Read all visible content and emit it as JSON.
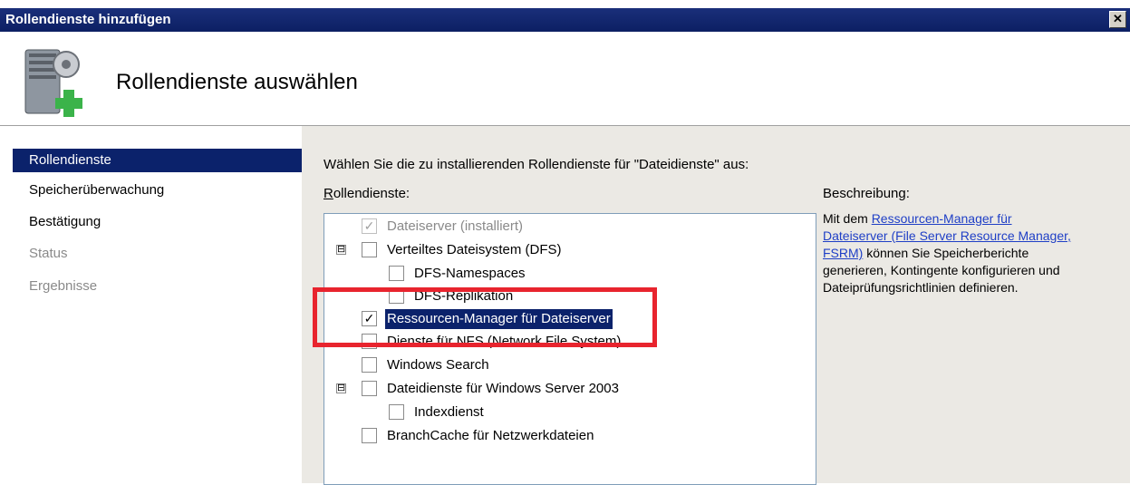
{
  "window": {
    "title": "Rollendienste hinzufügen",
    "close_label": "✕"
  },
  "header": {
    "title": "Rollendienste auswählen",
    "icon": "server-add-icon"
  },
  "nav": {
    "items": [
      {
        "label": "Rollendienste",
        "state": "active"
      },
      {
        "label": "Speicherüberwachung",
        "state": "normal"
      },
      {
        "label": "Bestätigung",
        "state": "normal"
      },
      {
        "label": "Status",
        "state": "disabled"
      },
      {
        "label": "Ergebnisse",
        "state": "disabled"
      }
    ]
  },
  "main": {
    "prompt": "Wählen Sie die zu installierenden Rollendienste für \"Dateidienste\" aus:",
    "list_label_accel": "R",
    "list_label_rest": "ollendienste:",
    "services": [
      {
        "label": "Dateiserver (installiert)",
        "checked": true,
        "disabled": true
      },
      {
        "label": "Verteiltes Dateisystem (DFS)",
        "checked": false,
        "expander": "⊟"
      },
      {
        "label": "DFS-Namespaces",
        "checked": false
      },
      {
        "label": "DFS-Replikation",
        "checked": false
      },
      {
        "label": "Ressourcen-Manager für Dateiserver",
        "checked": true,
        "selected": true
      },
      {
        "label": "Dienste für NFS (Network File System)",
        "checked": false
      },
      {
        "label": "Windows Search",
        "checked": false
      },
      {
        "label": "Dateidienste für Windows Server 2003",
        "checked": false,
        "expander": "⊟"
      },
      {
        "label": "Indexdienst",
        "checked": false
      },
      {
        "label": "BranchCache für Netzwerkdateien",
        "checked": false
      }
    ],
    "description": {
      "label": "Beschreibung:",
      "prefix": "Mit dem ",
      "link": "Ressourcen-Manager für Dateiserver (File Server Resource Manager, FSRM)",
      "suffix": " können Sie Speicherberichte generieren, Kontingente konfigurieren und Dateiprüfungsrichtlinien definieren."
    }
  },
  "colors": {
    "titlebar": "#0c1f63",
    "selection": "#0b226b",
    "highlight_box": "#e8242e",
    "link": "#1f3fc6",
    "panel": "#ebe9e4"
  }
}
